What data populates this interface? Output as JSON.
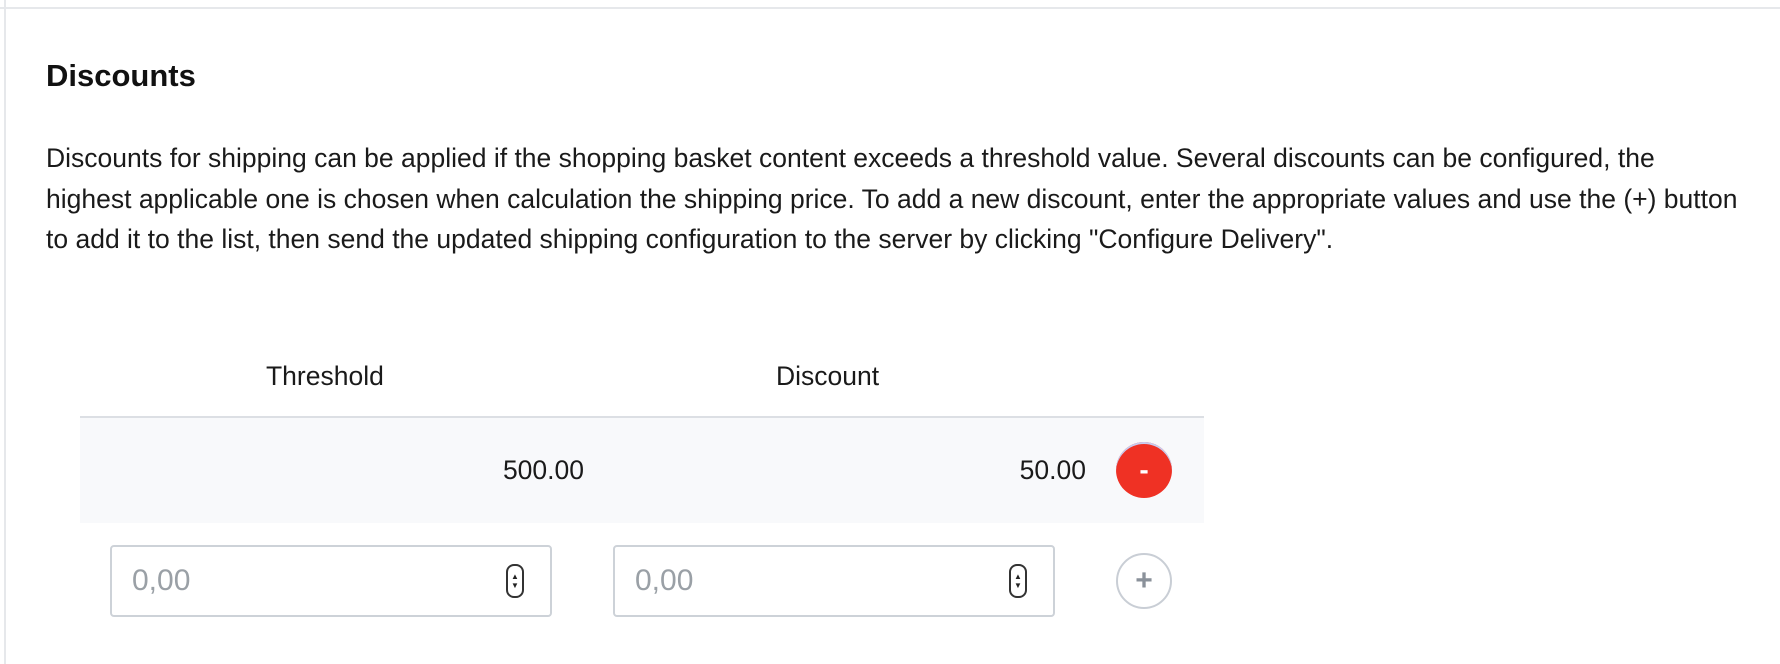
{
  "section": {
    "title": "Discounts",
    "description": "Discounts for shipping can be applied if the shopping basket content exceeds a threshold value. Several discounts can be configured, the highest applicable one is chosen when calculation the shipping price. To add a new discount, enter the appropriate values and use the (+) button to add it to the list, then send the updated shipping configuration to the server by clicking \"Configure Delivery\"."
  },
  "table": {
    "headers": {
      "threshold": "Threshold",
      "discount": "Discount"
    },
    "rows": [
      {
        "threshold": "500.00",
        "discount": "50.00",
        "remove_label": "-"
      }
    ]
  },
  "new_entry": {
    "threshold_placeholder": "0,00",
    "discount_placeholder": "0,00",
    "threshold_value": "",
    "discount_value": "",
    "add_label": "+"
  },
  "icons": {
    "spinner_up": "▲",
    "spinner_down": "▼"
  },
  "colors": {
    "remove_button": "#ef3124",
    "row_background": "#f8f9fb",
    "add_button_border": "#c9ced5"
  }
}
